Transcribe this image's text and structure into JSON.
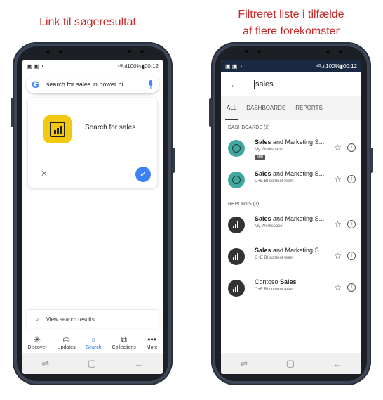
{
  "captions": {
    "left": "Link til søgeresultat",
    "right_line1": "Filtreret liste i tilfælde",
    "right_line2": "af flere forekomster"
  },
  "left_phone": {
    "status": {
      "icons": "▣ ▣ ◔",
      "right": "⁴ᴳ.ıl100%▮00:12"
    },
    "search_bar": {
      "logo": "G",
      "query": "search for sales in power bi",
      "mic_icon": "mic-icon"
    },
    "result_card": {
      "title": "Search for sales",
      "dismiss": "✕",
      "confirm": "✓"
    },
    "view_results": "View search results",
    "bottom_nav": [
      {
        "icon": "✳",
        "label": "Discover"
      },
      {
        "icon": "⛀",
        "label": "Updates"
      },
      {
        "icon": "⌕",
        "label": "Search"
      },
      {
        "icon": "⧉",
        "label": "Collections"
      },
      {
        "icon": "•••",
        "label": "More"
      }
    ],
    "nav_keys": [
      "⇌",
      "▢",
      "←"
    ]
  },
  "right_phone": {
    "status": {
      "icons": "▣ ▣ ◔",
      "right": "⁴ᴳ.ıl100%▮00:12"
    },
    "toolbar": {
      "back": "←",
      "query": "sales"
    },
    "tabs": [
      "ALL",
      "DASHBOARDS",
      "REPORTS"
    ],
    "dashboards_header": "DASHBOARDS (2)",
    "reports_header": "REPORTS (3)",
    "items": [
      {
        "type": "dashboard",
        "bold": "Sales",
        "rest": " and Marketing S...",
        "sub": "My Workspace",
        "badge": "MBI"
      },
      {
        "type": "dashboard",
        "bold": "Sales",
        "rest": " and Marketing S...",
        "sub": "C+E BI content team"
      },
      {
        "type": "report",
        "bold": "Sales",
        "rest": " and Marketing S...",
        "sub": "My Workspace"
      },
      {
        "type": "report",
        "bold": "Sales",
        "rest": " and Marketing S...",
        "sub": "C+E BI content team"
      },
      {
        "type": "report",
        "prefix": "Contoso ",
        "bold": "Sales",
        "rest": "",
        "sub": "C+E BI content team"
      }
    ],
    "star": "☆",
    "info": "i",
    "nav_keys": [
      "⇌",
      "▢",
      "←"
    ]
  },
  "colors": {
    "caption": "#c62828",
    "pbi_yellow": "#f2c811",
    "dash_teal": "#41a8a0",
    "status_dark": "#1a2942",
    "check_blue": "#3b82f6"
  }
}
